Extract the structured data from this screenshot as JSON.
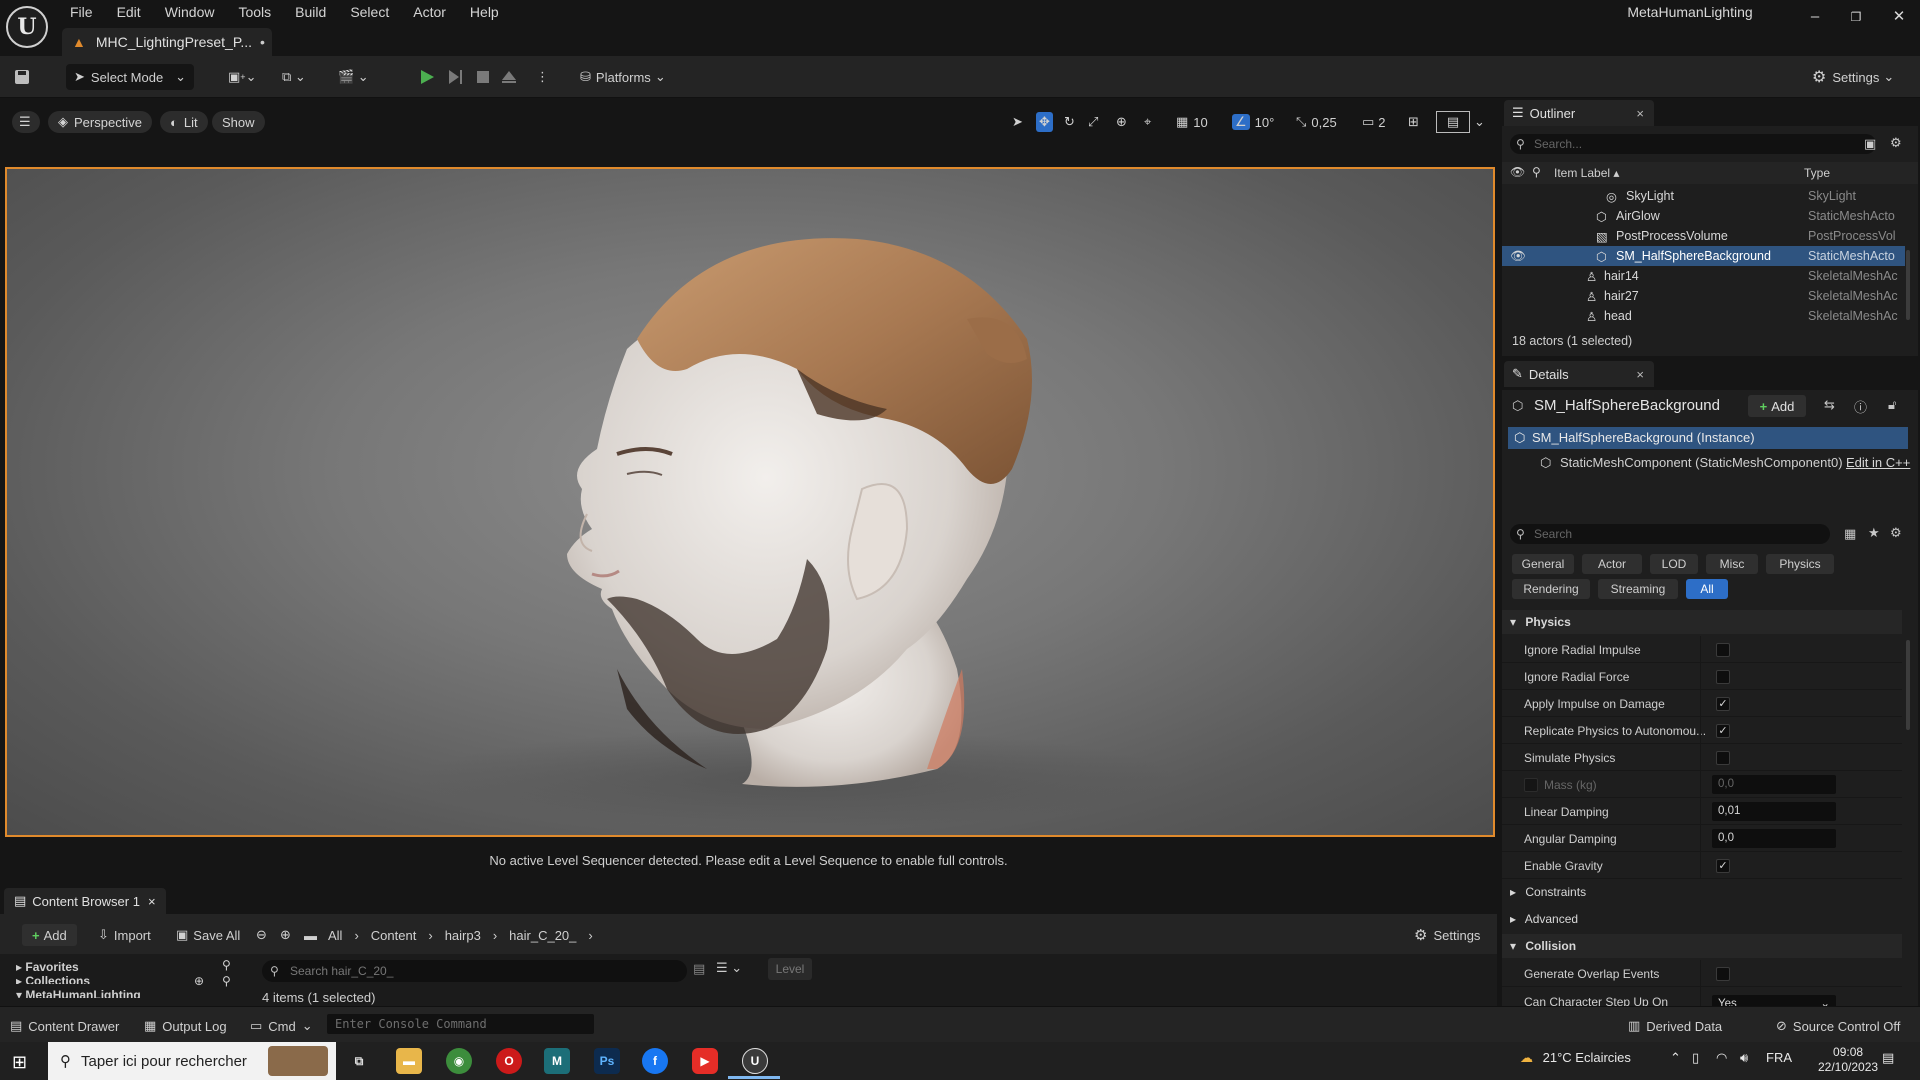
{
  "app": {
    "title": "MetaHumanLighting",
    "document_tab": "MHC_LightingPreset_P...",
    "menu": [
      "File",
      "Edit",
      "Window",
      "Tools",
      "Build",
      "Select",
      "Actor",
      "Help"
    ]
  },
  "toolbar": {
    "select_mode": "Select Mode",
    "platforms": "Platforms",
    "settings": "Settings"
  },
  "viewport": {
    "perspective": "Perspective",
    "lit": "Lit",
    "show": "Show",
    "grid_snap": "10",
    "rot_snap": "10°",
    "scale_snap": "0,25",
    "camera_speed": "2",
    "message": "No active Level Sequencer detected. Please edit a Level Sequence to enable full controls."
  },
  "content_browser": {
    "tab": "Content Browser 1",
    "add": "Add",
    "import": "Import",
    "save_all": "Save All",
    "breadcrumbs": [
      "All",
      "Content",
      "hairp3",
      "hair_C_20_"
    ],
    "settings": "Settings",
    "search_placeholder": "Search hair_C_20_",
    "filter": "Level",
    "items_count": "4 items (1 selected)",
    "tree": [
      "Favorites",
      "Collections",
      "MetaHumanLighting"
    ]
  },
  "statusbar": {
    "content_drawer": "Content Drawer",
    "output_log": "Output Log",
    "cmd": "Cmd",
    "console_placeholder": "Enter Console Command",
    "derived_data": "Derived Data",
    "source_control": "Source Control Off"
  },
  "outliner": {
    "tab": "Outliner",
    "search_placeholder": "Search...",
    "col_label": "Item Label",
    "col_type": "Type",
    "rows": [
      {
        "label": "SkyLight",
        "type": "SkyLight"
      },
      {
        "label": "AirGlow",
        "type": "StaticMeshActo"
      },
      {
        "label": "PostProcessVolume",
        "type": "PostProcessVol"
      },
      {
        "label": "SM_HalfSphereBackground",
        "type": "StaticMeshActo"
      },
      {
        "label": "hair14",
        "type": "SkeletalMeshAc"
      },
      {
        "label": "hair27",
        "type": "SkeletalMeshAc"
      },
      {
        "label": "head",
        "type": "SkeletalMeshAc"
      }
    ],
    "status": "18 actors (1 selected)"
  },
  "details": {
    "tab": "Details",
    "title": "SM_HalfSphereBackground",
    "add": "Add",
    "instance": "SM_HalfSphereBackground (Instance)",
    "component": "StaticMeshComponent (StaticMeshComponent0)",
    "edit_cpp": "Edit in C++",
    "search_placeholder": "Search",
    "categories": [
      "General",
      "Actor",
      "LOD",
      "Misc",
      "Physics",
      "Rendering",
      "Streaming",
      "All"
    ],
    "physics_header": "Physics",
    "props": {
      "ignore_radial_impulse": "Ignore Radial Impulse",
      "ignore_radial_force": "Ignore Radial Force",
      "apply_impulse": "Apply Impulse on Damage",
      "replicate_physics": "Replicate Physics to Autonomou...",
      "simulate_physics": "Simulate Physics",
      "mass": "Mass (kg)",
      "mass_value": "0,0",
      "linear_damping": "Linear Damping",
      "linear_damping_value": "0,01",
      "angular_damping": "Angular Damping",
      "angular_damping_value": "0,0",
      "enable_gravity": "Enable Gravity"
    },
    "constraints": "Constraints",
    "advanced": "Advanced",
    "collision_header": "Collision",
    "generate_overlap": "Generate Overlap Events",
    "can_step_up": "Can Character Step Up On",
    "can_step_up_value": "Yes"
  },
  "taskbar": {
    "search": "Taper ici pour rechercher",
    "weather": "21°C  Eclaircies",
    "lang": "FRA",
    "time": "09:08",
    "date": "22/10/2023"
  }
}
